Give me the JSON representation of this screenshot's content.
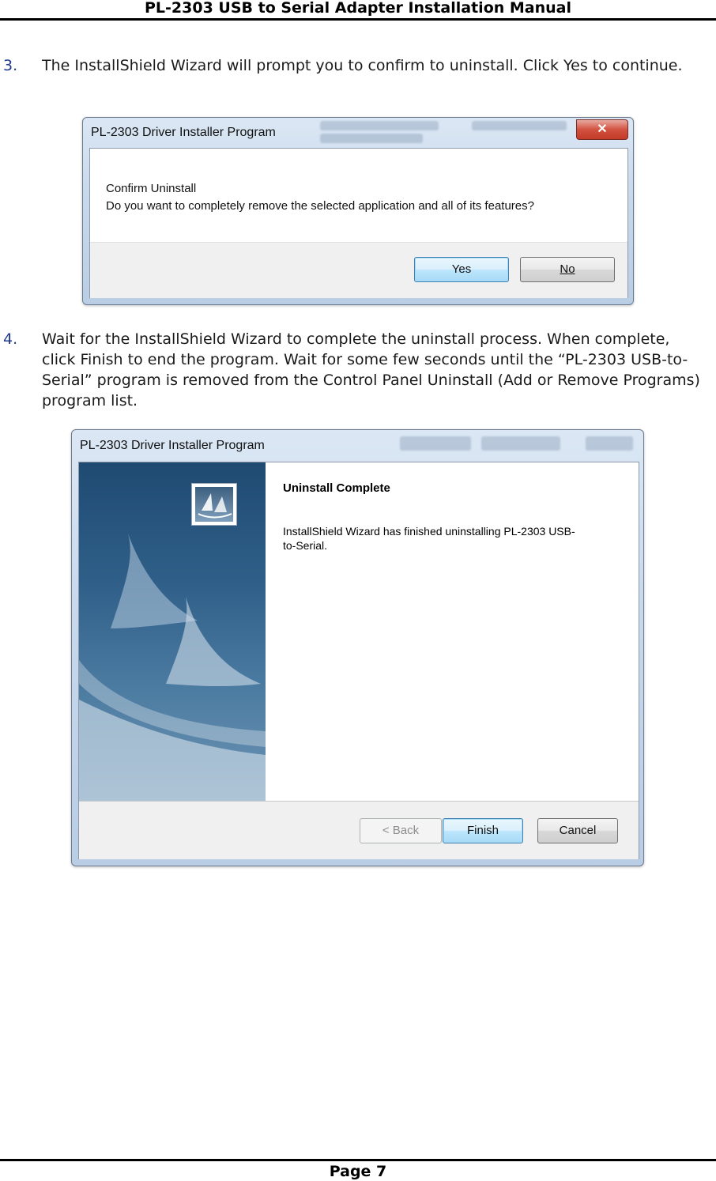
{
  "header": {
    "title": "PL-2303 USB to Serial Adapter Installation Manual"
  },
  "steps": [
    {
      "num": "3.",
      "text": "The InstallShield Wizard will prompt you to confirm to uninstall. Click Yes to continue."
    },
    {
      "num": "4.",
      "text": "Wait for the InstallShield Wizard to complete the uninstall process. When complete, click Finish to end the program. Wait for some few seconds until the “PL-2303 USB-to-Serial” program is removed from the Control Panel Uninstall (Add or Remove Programs) program list."
    }
  ],
  "dialog_confirm": {
    "title": "PL-2303 Driver Installer Program",
    "close_glyph": "✕",
    "heading": "Confirm Uninstall",
    "question": "Do you want to completely remove the selected application and all of its features?",
    "yes_label": "Yes",
    "no_label": "No"
  },
  "dialog_complete": {
    "title": "PL-2303 Driver Installer Program",
    "heading": "Uninstall Complete",
    "body": "InstallShield Wizard has finished uninstalling PL-2303 USB-to-Serial.",
    "back_label": "< Back",
    "finish_label": "Finish",
    "cancel_label": "Cancel"
  },
  "footer": {
    "page": "Page 7"
  }
}
